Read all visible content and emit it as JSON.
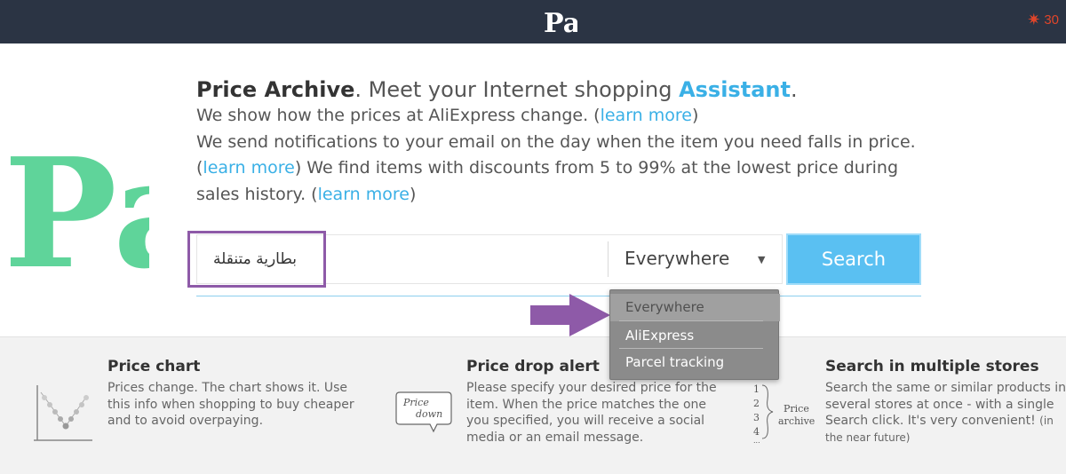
{
  "header": {
    "logo_text": "Pa",
    "notification_count": "30"
  },
  "side_logo": {
    "text": "Pa"
  },
  "intro": {
    "brand": "Price Archive",
    "headline_middle": ". Meet your Internet shopping ",
    "headline_accent": "Assistant",
    "headline_end": ".",
    "line1_text": "We show how the prices at AliExpress change. (",
    "learn_more": "learn more",
    "close_paren": ")",
    "line2_text": "We send notifications to your email on the day when the item you need falls in price.",
    "line3_open": "(",
    "line3_text": ") We find items with discounts from 5 to 99% at the lowest price during sales history. ("
  },
  "search": {
    "query": "بطارية متنقلة",
    "scope_selected": "Everywhere",
    "button_label": "Search"
  },
  "dropdown": {
    "options": [
      "Everywhere",
      "AliExpress",
      "Parcel tracking"
    ]
  },
  "features": [
    {
      "title": "Price chart",
      "text": "Prices change. The chart shows it. Use this info when shopping to buy cheaper and to avoid overpaying."
    },
    {
      "title": "Price drop alert",
      "text": "Please specify your desired price for the item. When the price matches the one you specified, you will receive a social media or an email message.",
      "icon_line1": "Price",
      "icon_line2": "down"
    },
    {
      "title": "Search in multiple stores",
      "text": "Search the same or similar products in several stores at once - with a single Search click. It's very convenient! ",
      "note": "(in the near future)",
      "icon_label1": "Price",
      "icon_label2": "archive",
      "icon_nums": [
        "1",
        "2",
        "3",
        "4"
      ]
    }
  ],
  "colors": {
    "topbar": "#2b3444",
    "accent": "#3ab0e6",
    "highlight": "#8e5aa8",
    "button": "#5ac0f2",
    "logo_green": "#5fd49a",
    "logo_purple": "#c39be0"
  }
}
